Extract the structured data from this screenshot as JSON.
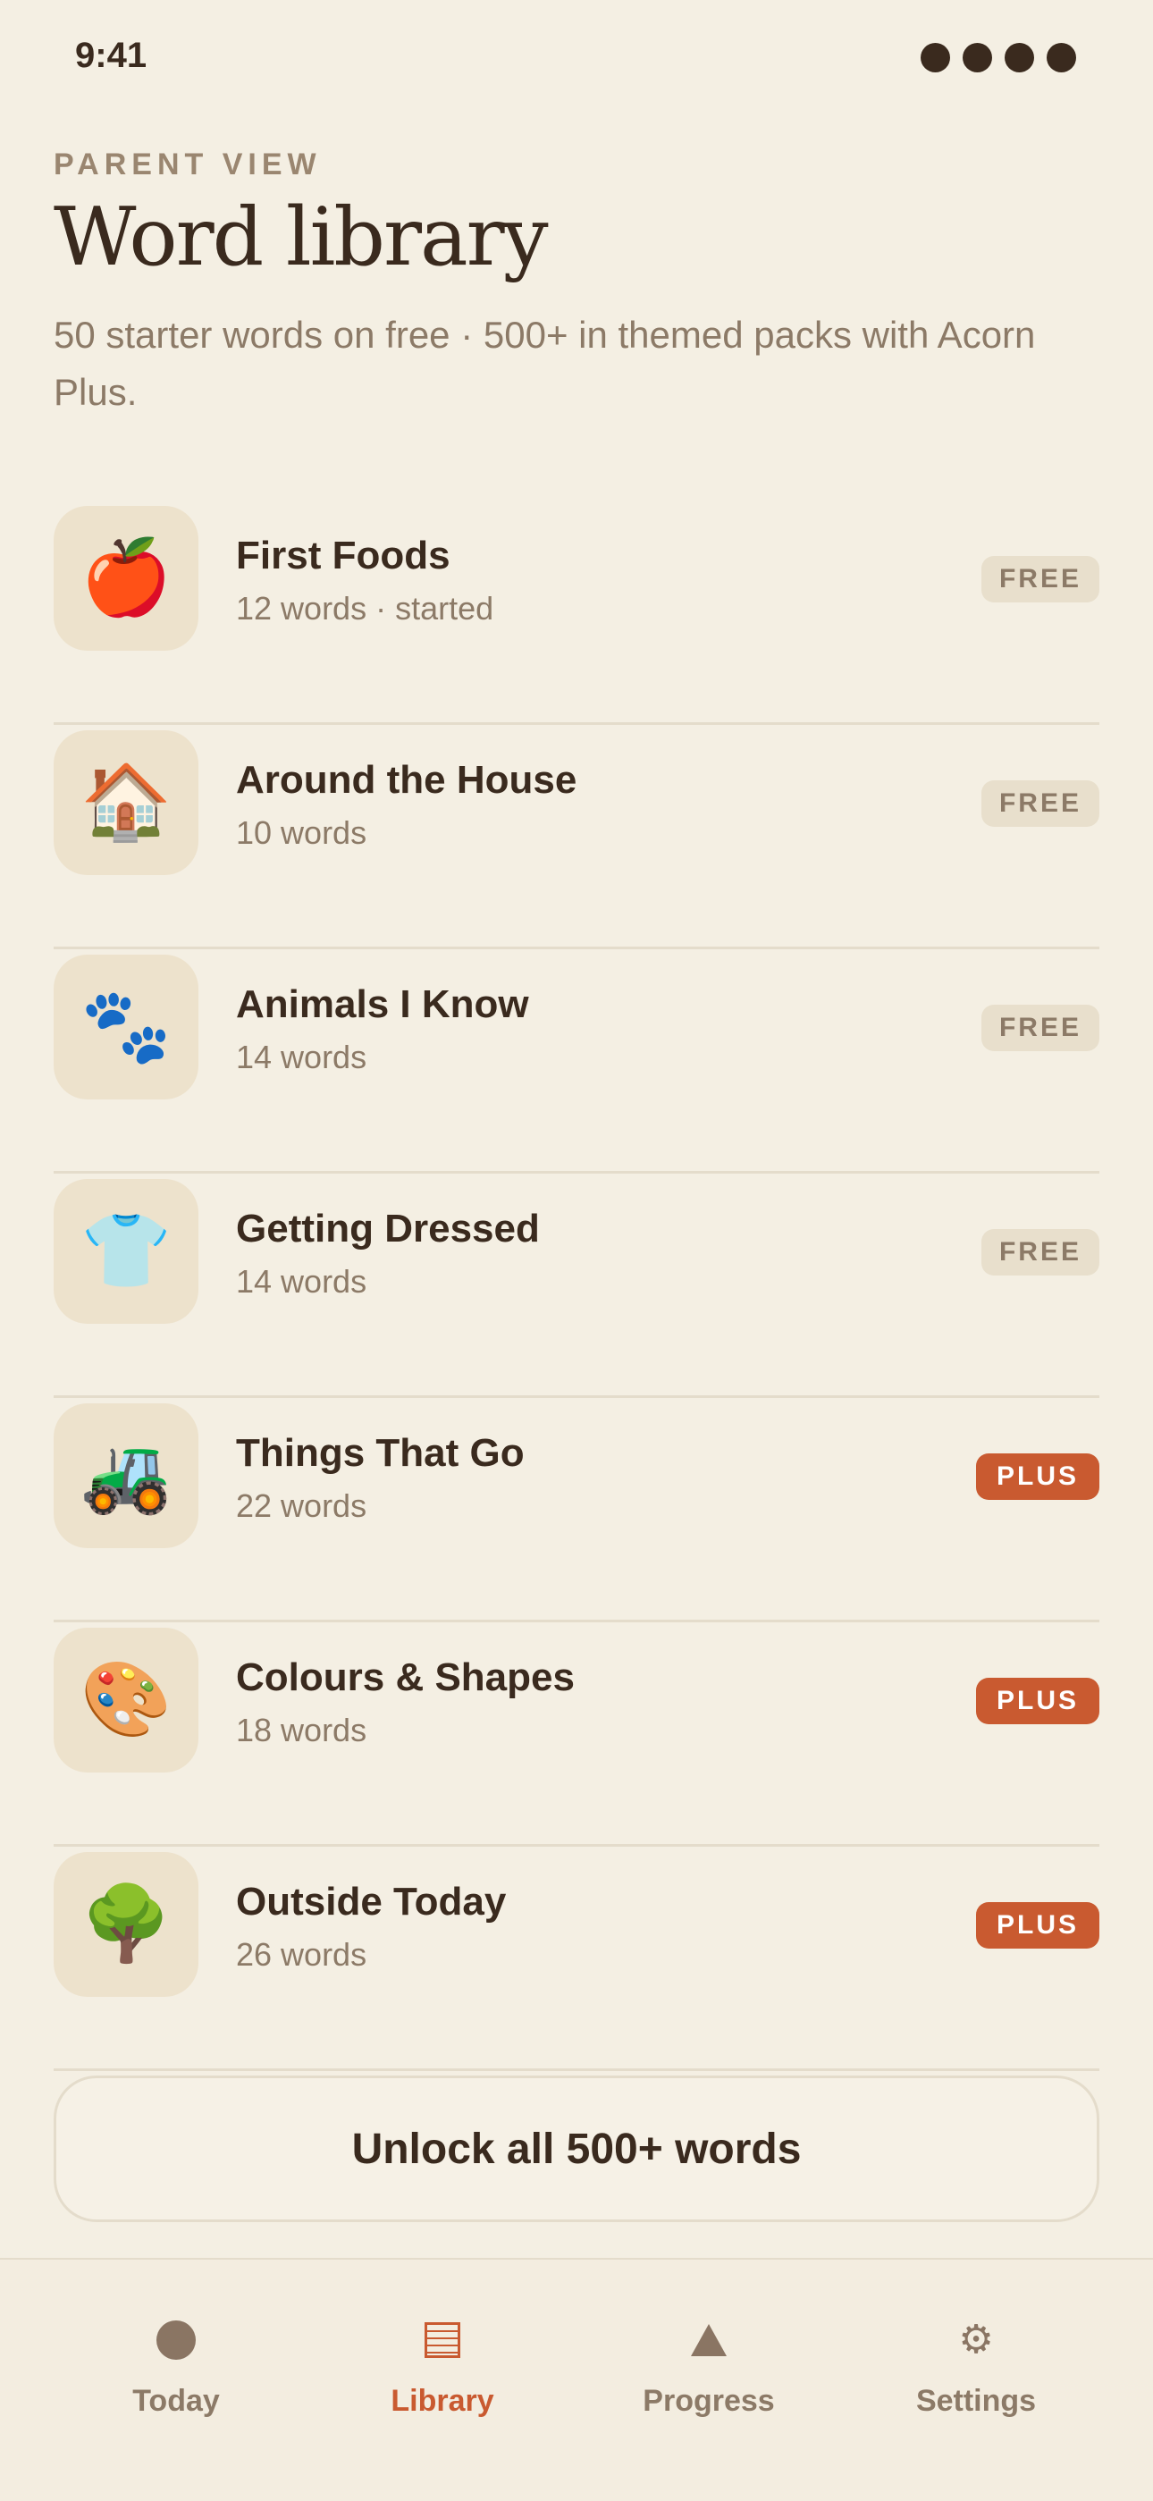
{
  "status_bar": {
    "time": "9:41"
  },
  "header": {
    "eyebrow": "PARENT VIEW",
    "title": "Word library",
    "subtitle": "50 starter words on free · 500+ in themed packs with Acorn Plus."
  },
  "packs": [
    {
      "icon": "🍎",
      "icon_name": "apple-icon",
      "title": "First Foods",
      "subtitle": "12 words · started",
      "badge": "FREE",
      "tier": "free"
    },
    {
      "icon": "🏠",
      "icon_name": "house-icon",
      "title": "Around the House",
      "subtitle": "10 words",
      "badge": "FREE",
      "tier": "free"
    },
    {
      "icon": "🐾",
      "icon_name": "paw-prints-icon",
      "title": "Animals I Know",
      "subtitle": "14 words",
      "badge": "FREE",
      "tier": "free"
    },
    {
      "icon": "👕",
      "icon_name": "shirt-icon",
      "title": "Getting Dressed",
      "subtitle": "14 words",
      "badge": "FREE",
      "tier": "free"
    },
    {
      "icon": "🚜",
      "icon_name": "tractor-icon",
      "title": "Things That Go",
      "subtitle": "22 words",
      "badge": "PLUS",
      "tier": "plus"
    },
    {
      "icon": "🎨",
      "icon_name": "palette-icon",
      "title": "Colours & Shapes",
      "subtitle": "18 words",
      "badge": "PLUS",
      "tier": "plus"
    },
    {
      "icon": "🌳",
      "icon_name": "tree-icon",
      "title": "Outside Today",
      "subtitle": "26 words",
      "badge": "PLUS",
      "tier": "plus"
    }
  ],
  "unlock_button": {
    "label": "Unlock all 500+ words"
  },
  "tab_bar": {
    "tabs": [
      {
        "label": "Today",
        "icon": "circle-icon",
        "active": false
      },
      {
        "label": "Library",
        "icon": "library-icon",
        "active": true
      },
      {
        "label": "Progress",
        "icon": "triangle-icon",
        "active": false
      },
      {
        "label": "Settings",
        "icon": "gear-icon",
        "active": false
      }
    ]
  },
  "colors": {
    "background": "#f4efe3",
    "text": "#3a2a1e",
    "muted": "#8c7a67",
    "accent": "#c95a30",
    "tile": "#ede2cc",
    "free_badge": "#e8dfcc"
  }
}
